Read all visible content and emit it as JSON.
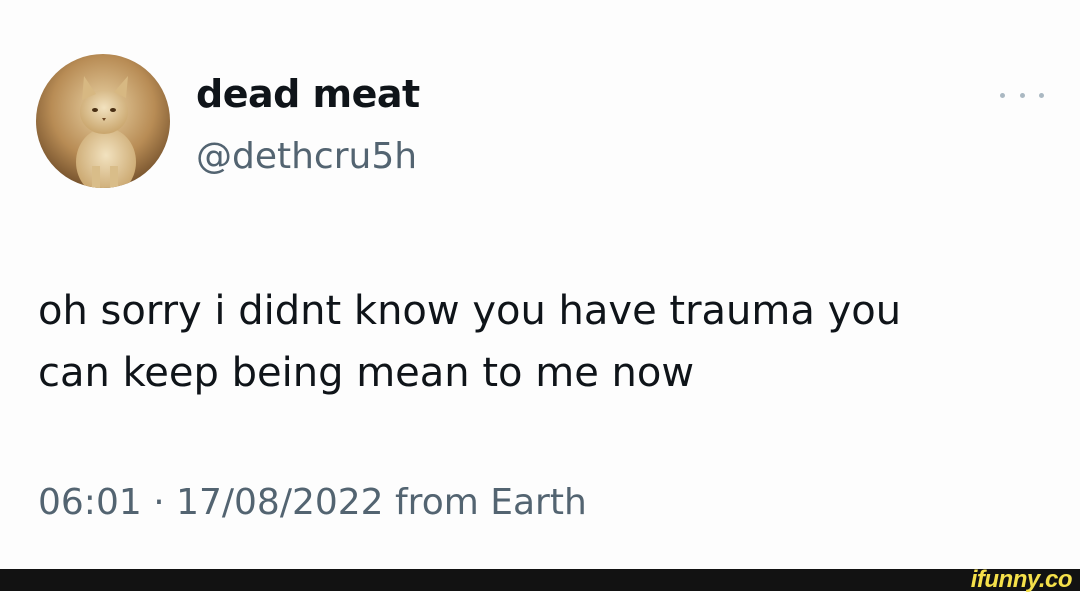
{
  "tweet": {
    "display_name": "dead meat",
    "handle": "@dethcru5h",
    "avatar_icon": "kitten-photo-avatar",
    "more_icon": "ellipsis-icon",
    "text_lines": [
      "oh sorry i didnt know you have trauma you",
      "can keep being mean to me now"
    ],
    "meta": "06:01 · 17/08/2022 from Earth"
  },
  "watermark": {
    "text": "ifunny.co"
  },
  "colors": {
    "name": "#0f1419",
    "secondary_text": "#536471",
    "watermark": "#f5e04a",
    "footer_bar": "#121212"
  }
}
